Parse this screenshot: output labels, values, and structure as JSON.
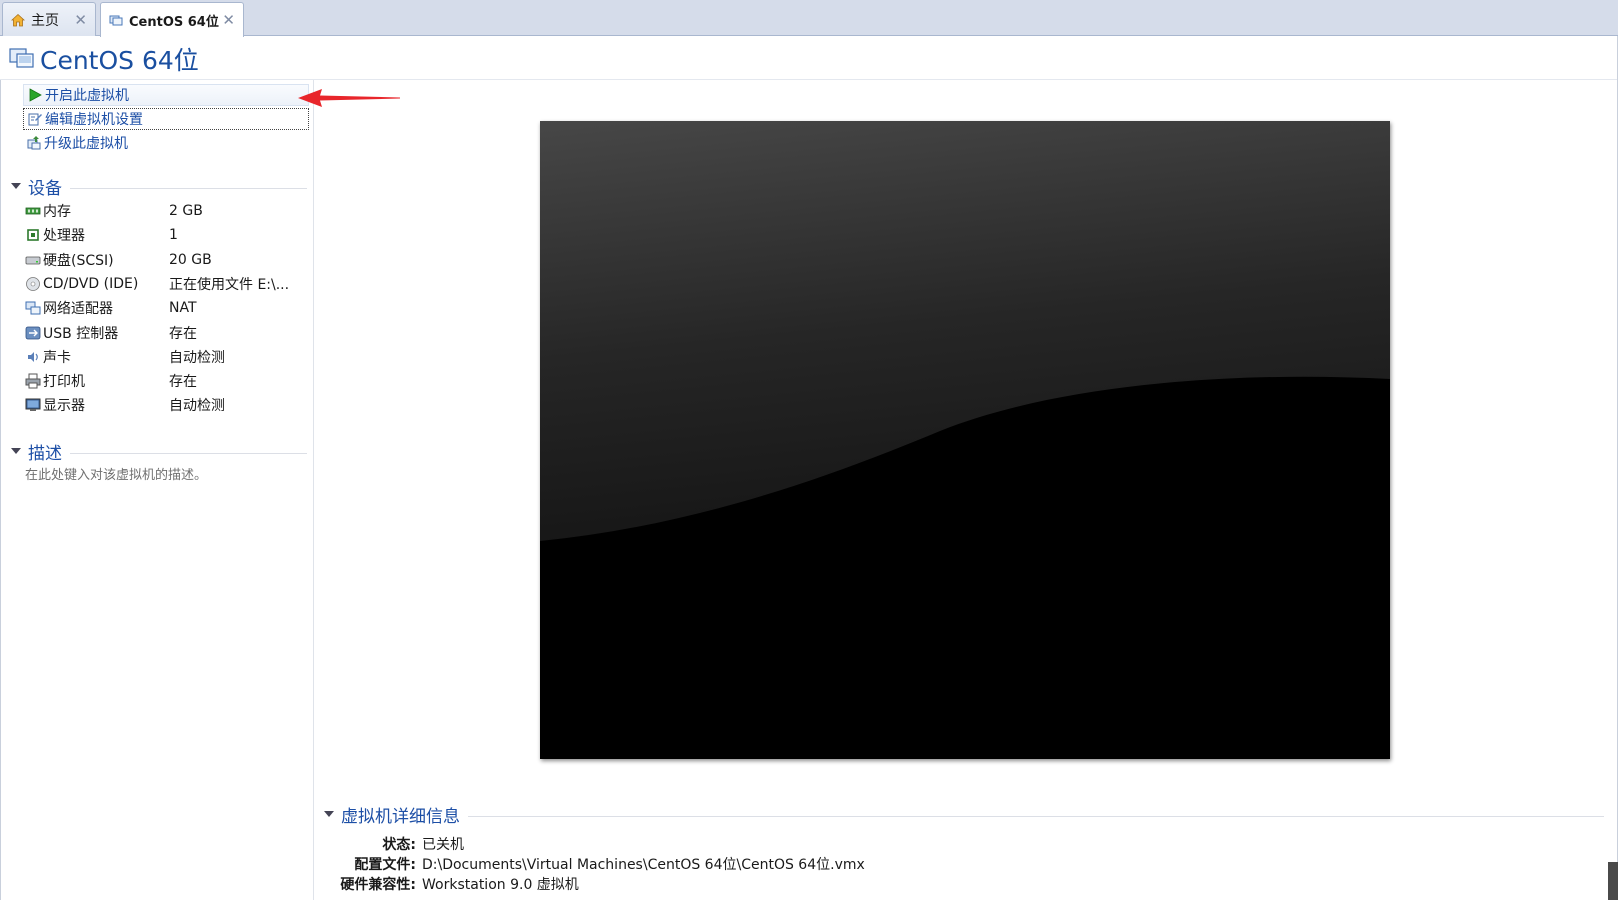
{
  "tabs": {
    "home_label": "主页",
    "vm_label": "CentOS 64位",
    "close_glyph": "✕"
  },
  "title": "CentOS 64位",
  "commands": {
    "power_on": "开启此虚拟机",
    "edit_settings": "编辑虚拟机设置",
    "upgrade": "升级此虚拟机"
  },
  "devices": {
    "heading": "设备",
    "items": [
      {
        "name": "内存",
        "value": "2 GB",
        "icon": "memory-icon"
      },
      {
        "name": "处理器",
        "value": "1",
        "icon": "processor-icon"
      },
      {
        "name": "硬盘(SCSI)",
        "value": "20 GB",
        "icon": "hard-disk-icon"
      },
      {
        "name": "CD/DVD (IDE)",
        "value": "正在使用文件 E:\\...",
        "icon": "cd-dvd-icon"
      },
      {
        "name": "网络适配器",
        "value": "NAT",
        "icon": "network-adapter-icon"
      },
      {
        "name": "USB 控制器",
        "value": "存在",
        "icon": "usb-controller-icon"
      },
      {
        "name": "声卡",
        "value": "自动检测",
        "icon": "sound-card-icon"
      },
      {
        "name": "打印机",
        "value": "存在",
        "icon": "printer-icon"
      },
      {
        "name": "显示器",
        "value": "自动检测",
        "icon": "display-icon"
      }
    ]
  },
  "description": {
    "heading": "描述",
    "placeholder": "在此处键入对该虚拟机的描述。"
  },
  "details": {
    "heading": "虚拟机详细信息",
    "rows": [
      {
        "key": "状态:",
        "value": "已关机"
      },
      {
        "key": "配置文件:",
        "value": "D:\\Documents\\Virtual Machines\\CentOS 64位\\CentOS 64位.vmx"
      },
      {
        "key": "硬件兼容性:",
        "value": "Workstation 9.0 虚拟机"
      }
    ]
  },
  "colors": {
    "accent": "#1d4fa6",
    "annotation_arrow": "#e8262b"
  }
}
